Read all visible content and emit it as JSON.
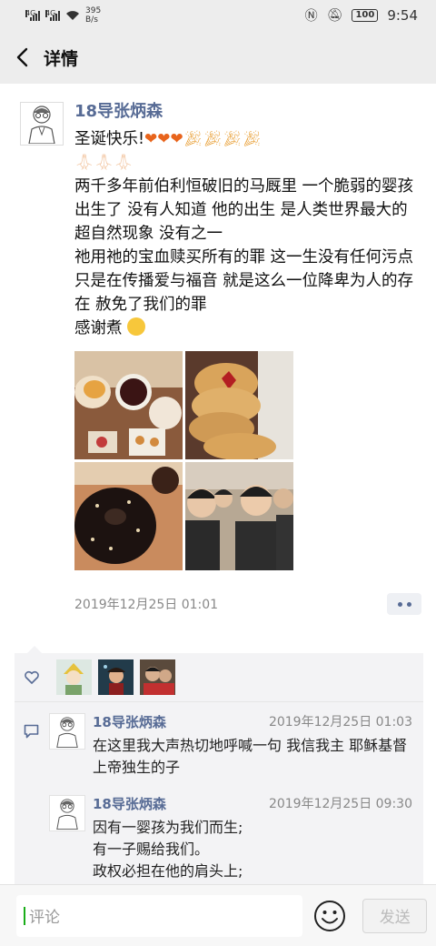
{
  "status_bar": {
    "network_1": "4G",
    "network_2": "4G",
    "speed_value": "395",
    "speed_unit": "B/s",
    "battery": "100",
    "time": "9:54"
  },
  "nav": {
    "title": "详情"
  },
  "post": {
    "author": "18导张炳森",
    "greeting": "圣诞快乐!",
    "body": "两千多年前伯利恒破旧的马厩里 一个脆弱的婴孩出生了 没有人知道 他的出生 是人类世界最大的超自然现象 没有之一\n祂用祂的宝血赎买所有的罪 这一生没有任何污点 只是在传播爱与福音 就是这么一位降卑为人的存在 赦免了我们的罪",
    "closing": "感谢煮",
    "timestamp": "2019年12月25日 01:01"
  },
  "comments": [
    {
      "name": "18导张炳森",
      "time": "2019年12月25日 01:03",
      "text": "在这里我大声热切地呼喊一句 我信我主 耶稣基督 上帝独生的子"
    },
    {
      "name": "18导张炳森",
      "time": "2019年12月25日 09:30",
      "text": "因有一婴孩为我们而生;\n有一子赐给我们。\n政权必担在他的肩头上;\n他名称为\"奇妙策士、全能的  神、永在的"
    }
  ],
  "input": {
    "placeholder": "评论",
    "send_label": "发送"
  },
  "colors": {
    "accent_link": "#576b95",
    "header_bg": "#ededed",
    "comment_bg": "#f3f3f5"
  },
  "icons": [
    "back-arrow-icon",
    "heart-icon",
    "comment-icon",
    "emoji-icon",
    "more-dots-icon"
  ]
}
